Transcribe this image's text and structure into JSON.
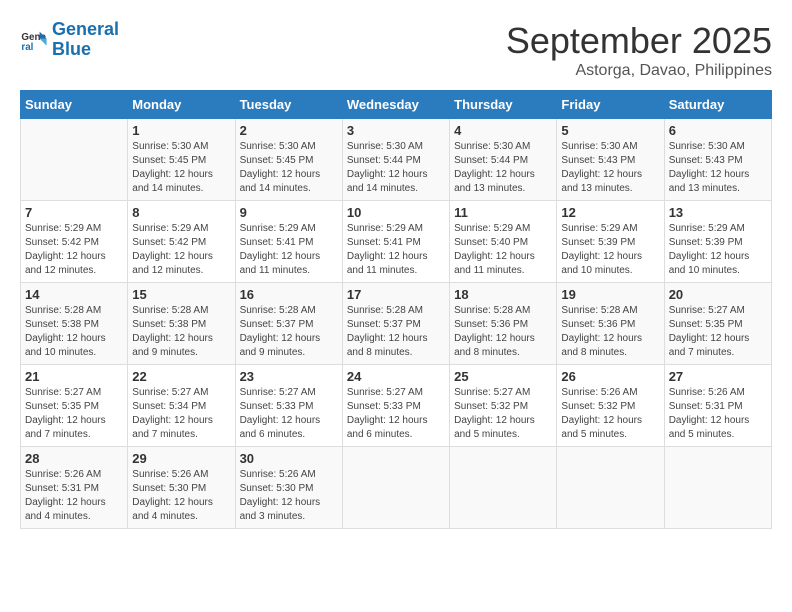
{
  "header": {
    "logo_line1": "General",
    "logo_line2": "Blue",
    "month": "September 2025",
    "location": "Astorga, Davao, Philippines"
  },
  "days_of_week": [
    "Sunday",
    "Monday",
    "Tuesday",
    "Wednesday",
    "Thursday",
    "Friday",
    "Saturday"
  ],
  "weeks": [
    [
      {
        "day": "",
        "info": ""
      },
      {
        "day": "1",
        "info": "Sunrise: 5:30 AM\nSunset: 5:45 PM\nDaylight: 12 hours\nand 14 minutes."
      },
      {
        "day": "2",
        "info": "Sunrise: 5:30 AM\nSunset: 5:45 PM\nDaylight: 12 hours\nand 14 minutes."
      },
      {
        "day": "3",
        "info": "Sunrise: 5:30 AM\nSunset: 5:44 PM\nDaylight: 12 hours\nand 14 minutes."
      },
      {
        "day": "4",
        "info": "Sunrise: 5:30 AM\nSunset: 5:44 PM\nDaylight: 12 hours\nand 13 minutes."
      },
      {
        "day": "5",
        "info": "Sunrise: 5:30 AM\nSunset: 5:43 PM\nDaylight: 12 hours\nand 13 minutes."
      },
      {
        "day": "6",
        "info": "Sunrise: 5:30 AM\nSunset: 5:43 PM\nDaylight: 12 hours\nand 13 minutes."
      }
    ],
    [
      {
        "day": "7",
        "info": "Sunrise: 5:29 AM\nSunset: 5:42 PM\nDaylight: 12 hours\nand 12 minutes."
      },
      {
        "day": "8",
        "info": "Sunrise: 5:29 AM\nSunset: 5:42 PM\nDaylight: 12 hours\nand 12 minutes."
      },
      {
        "day": "9",
        "info": "Sunrise: 5:29 AM\nSunset: 5:41 PM\nDaylight: 12 hours\nand 11 minutes."
      },
      {
        "day": "10",
        "info": "Sunrise: 5:29 AM\nSunset: 5:41 PM\nDaylight: 12 hours\nand 11 minutes."
      },
      {
        "day": "11",
        "info": "Sunrise: 5:29 AM\nSunset: 5:40 PM\nDaylight: 12 hours\nand 11 minutes."
      },
      {
        "day": "12",
        "info": "Sunrise: 5:29 AM\nSunset: 5:39 PM\nDaylight: 12 hours\nand 10 minutes."
      },
      {
        "day": "13",
        "info": "Sunrise: 5:29 AM\nSunset: 5:39 PM\nDaylight: 12 hours\nand 10 minutes."
      }
    ],
    [
      {
        "day": "14",
        "info": "Sunrise: 5:28 AM\nSunset: 5:38 PM\nDaylight: 12 hours\nand 10 minutes."
      },
      {
        "day": "15",
        "info": "Sunrise: 5:28 AM\nSunset: 5:38 PM\nDaylight: 12 hours\nand 9 minutes."
      },
      {
        "day": "16",
        "info": "Sunrise: 5:28 AM\nSunset: 5:37 PM\nDaylight: 12 hours\nand 9 minutes."
      },
      {
        "day": "17",
        "info": "Sunrise: 5:28 AM\nSunset: 5:37 PM\nDaylight: 12 hours\nand 8 minutes."
      },
      {
        "day": "18",
        "info": "Sunrise: 5:28 AM\nSunset: 5:36 PM\nDaylight: 12 hours\nand 8 minutes."
      },
      {
        "day": "19",
        "info": "Sunrise: 5:28 AM\nSunset: 5:36 PM\nDaylight: 12 hours\nand 8 minutes."
      },
      {
        "day": "20",
        "info": "Sunrise: 5:27 AM\nSunset: 5:35 PM\nDaylight: 12 hours\nand 7 minutes."
      }
    ],
    [
      {
        "day": "21",
        "info": "Sunrise: 5:27 AM\nSunset: 5:35 PM\nDaylight: 12 hours\nand 7 minutes."
      },
      {
        "day": "22",
        "info": "Sunrise: 5:27 AM\nSunset: 5:34 PM\nDaylight: 12 hours\nand 7 minutes."
      },
      {
        "day": "23",
        "info": "Sunrise: 5:27 AM\nSunset: 5:33 PM\nDaylight: 12 hours\nand 6 minutes."
      },
      {
        "day": "24",
        "info": "Sunrise: 5:27 AM\nSunset: 5:33 PM\nDaylight: 12 hours\nand 6 minutes."
      },
      {
        "day": "25",
        "info": "Sunrise: 5:27 AM\nSunset: 5:32 PM\nDaylight: 12 hours\nand 5 minutes."
      },
      {
        "day": "26",
        "info": "Sunrise: 5:26 AM\nSunset: 5:32 PM\nDaylight: 12 hours\nand 5 minutes."
      },
      {
        "day": "27",
        "info": "Sunrise: 5:26 AM\nSunset: 5:31 PM\nDaylight: 12 hours\nand 5 minutes."
      }
    ],
    [
      {
        "day": "28",
        "info": "Sunrise: 5:26 AM\nSunset: 5:31 PM\nDaylight: 12 hours\nand 4 minutes."
      },
      {
        "day": "29",
        "info": "Sunrise: 5:26 AM\nSunset: 5:30 PM\nDaylight: 12 hours\nand 4 minutes."
      },
      {
        "day": "30",
        "info": "Sunrise: 5:26 AM\nSunset: 5:30 PM\nDaylight: 12 hours\nand 3 minutes."
      },
      {
        "day": "",
        "info": ""
      },
      {
        "day": "",
        "info": ""
      },
      {
        "day": "",
        "info": ""
      },
      {
        "day": "",
        "info": ""
      }
    ]
  ]
}
